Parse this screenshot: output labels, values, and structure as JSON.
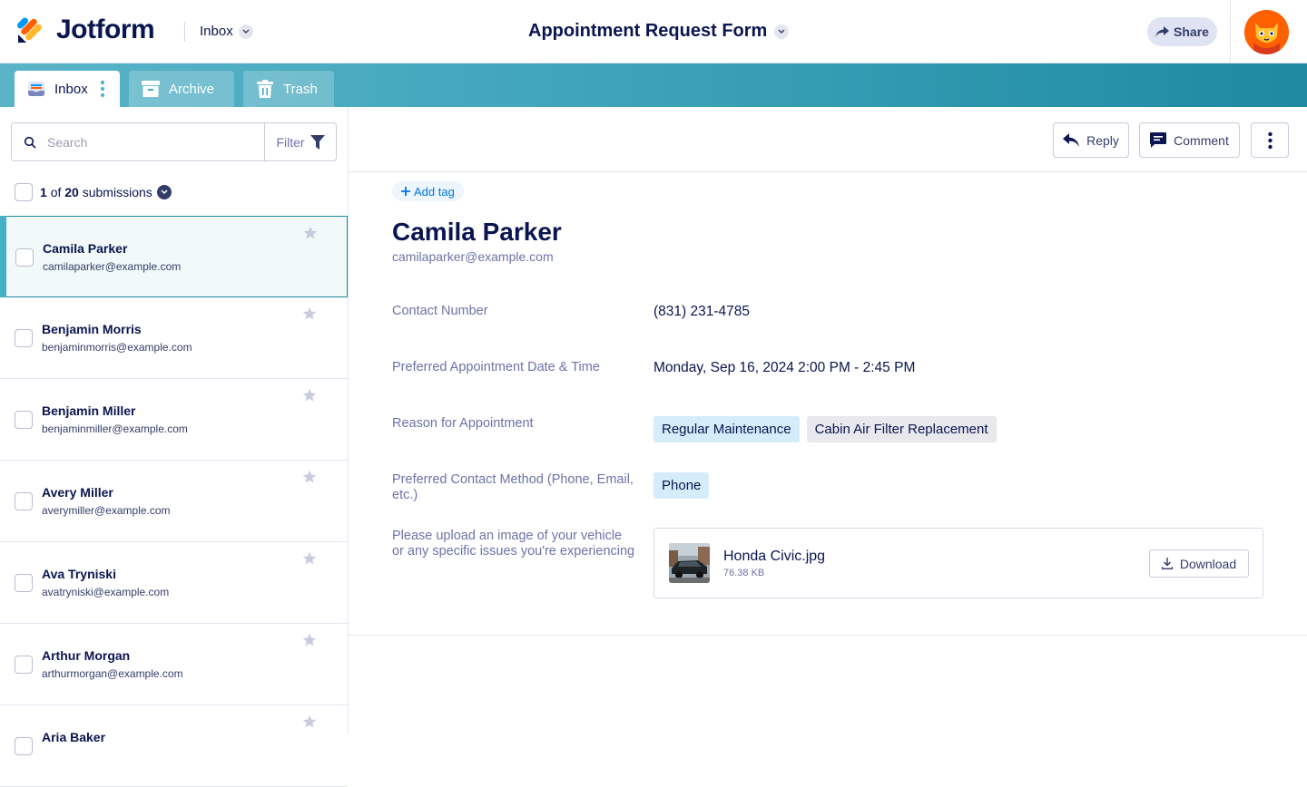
{
  "header": {
    "brand": "Jotform",
    "inbox_label": "Inbox",
    "form_title": "Appointment Request Form",
    "share_label": "Share"
  },
  "tabs": [
    {
      "label": "Inbox"
    },
    {
      "label": "Archive"
    },
    {
      "label": "Trash"
    }
  ],
  "search": {
    "placeholder": "Search",
    "filter_label": "Filter"
  },
  "submissions": {
    "current": "1",
    "of": "of",
    "total": "20",
    "suffix": "submissions",
    "items": [
      {
        "name": "Camila Parker",
        "email": "camilaparker@example.com"
      },
      {
        "name": "Benjamin Morris",
        "email": "benjaminmorris@example.com"
      },
      {
        "name": "Benjamin Miller",
        "email": "benjaminmiller@example.com"
      },
      {
        "name": "Avery Miller",
        "email": "averymiller@example.com"
      },
      {
        "name": "Ava Tryniski",
        "email": "avatryniski@example.com"
      },
      {
        "name": "Arthur Morgan",
        "email": "arthurmorgan@example.com"
      },
      {
        "name": "Aria Baker",
        "email": ""
      }
    ]
  },
  "toolbar": {
    "reply_label": "Reply",
    "comment_label": "Comment"
  },
  "detail": {
    "add_tag": "Add tag",
    "name": "Camila Parker",
    "email": "camilaparker@example.com",
    "fields": [
      {
        "label": "Contact Number",
        "value": "(831) 231-4785"
      },
      {
        "label": "Preferred Appointment Date & Time",
        "value": "Monday, Sep 16, 2024 2:00 PM - 2:45 PM"
      },
      {
        "label": "Reason for Appointment",
        "chips": [
          "Regular Maintenance",
          "Cabin Air Filter Replacement"
        ]
      },
      {
        "label": "Preferred Contact Method (Phone, Email, etc.)",
        "chips": [
          "Phone"
        ]
      },
      {
        "label": "Please upload an image of your vehicle or any specific issues you're experiencing"
      }
    ],
    "file": {
      "name": "Honda Civic.jpg",
      "size": "76.38 KB",
      "download_label": "Download"
    }
  },
  "colors": {
    "brand_teal": "#1d8aa2",
    "accent_blue": "#0075e3",
    "navy": "#0a1551"
  }
}
